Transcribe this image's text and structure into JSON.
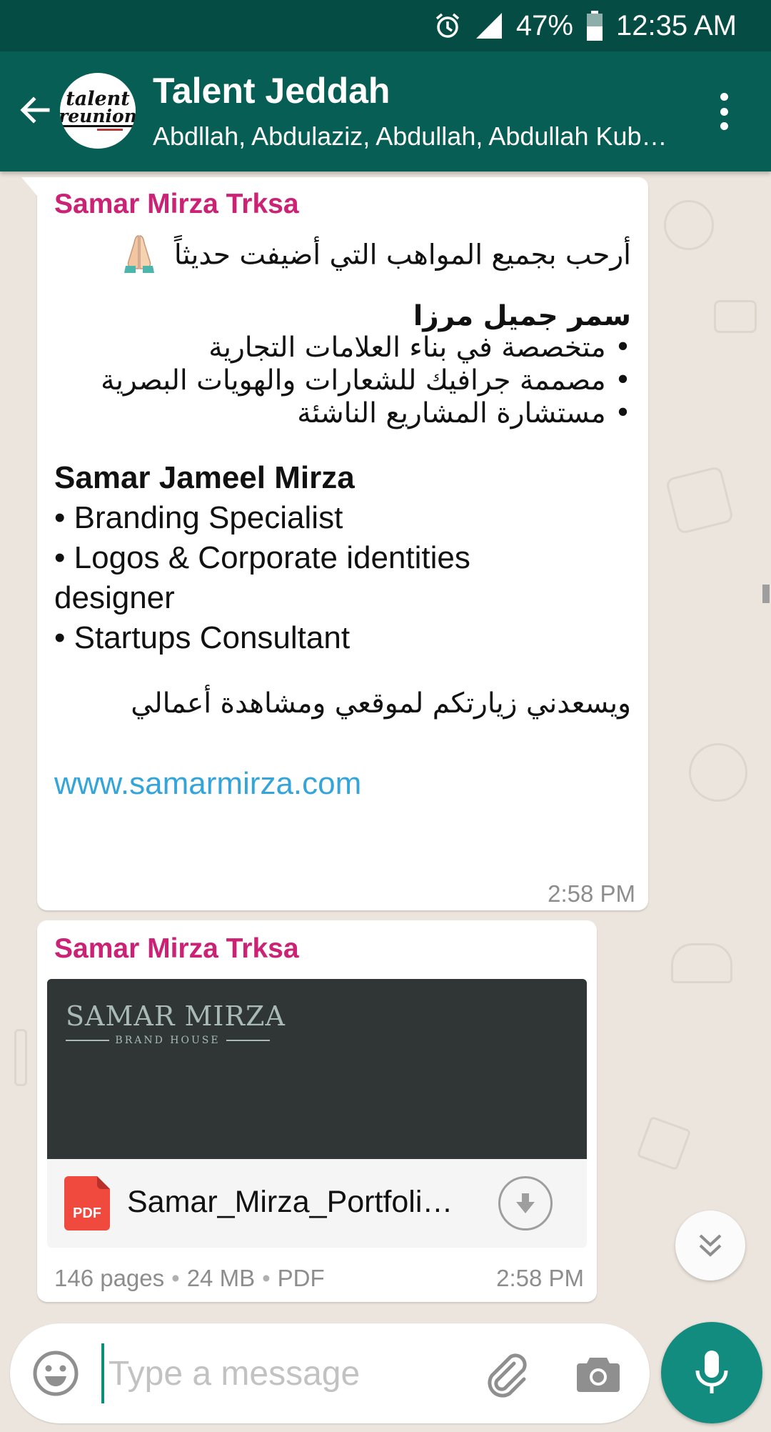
{
  "status_bar": {
    "battery": "47%",
    "time": "12:35 AM",
    "icons": [
      "alarm-icon",
      "signal-icon",
      "battery-icon"
    ]
  },
  "header": {
    "title": "Talent Jeddah",
    "subtitle": "Abdllah, Abdulaziz, Abdullah, Abdullah Kubur, Abdulrahman",
    "avatar_line1": "talent",
    "avatar_line2": "reunion",
    "icons": [
      "back-arrow-icon",
      "more-vert-icon"
    ]
  },
  "messages": [
    {
      "sender": "Samar Mirza Trksa",
      "arabic_welcome": "أرحب بجميع المواهب التي أضيفت حديثاً",
      "arabic_name": "سمر جميل مرزا",
      "arabic_bullets": [
        "• متخصصة في بناء العلامات التجارية",
        "• مصممة جرافيك للشعارات والهويات البصرية",
        "• مستشارة المشاريع الناشئة"
      ],
      "english_name": "Samar Jameel Mirza",
      "english_lines": [
        "• Branding Specialist",
        "• Logos & Corporate identities",
        "designer",
        "• Startups Consultant"
      ],
      "arabic_closing": "ويسعدني زيارتكم لموقعي ومشاهدة أعمالي",
      "link": "www.samarmirza.com",
      "time": "2:58 PM"
    },
    {
      "sender": "Samar Mirza Trksa",
      "preview_brand": "SAMAR MIRZA",
      "preview_tagline": "BRAND HOUSE",
      "pdf_badge": "PDF",
      "file_name": "Samar_Mirza_Portfolio.pdf",
      "pages": "146 pages",
      "size": "24 MB",
      "file_type": "PDF",
      "time": "2:58 PM"
    }
  ],
  "composer": {
    "placeholder": "Type a message",
    "icons": [
      "emoji-icon",
      "attach-icon",
      "camera-icon",
      "mic-icon"
    ]
  },
  "colors": {
    "status_bar": "#054d44",
    "app_bar": "#075e54",
    "chat_background": "#ece5dd",
    "sender_name": "#cc2275",
    "link": "#34a5db",
    "mic_button": "#128c7e"
  }
}
